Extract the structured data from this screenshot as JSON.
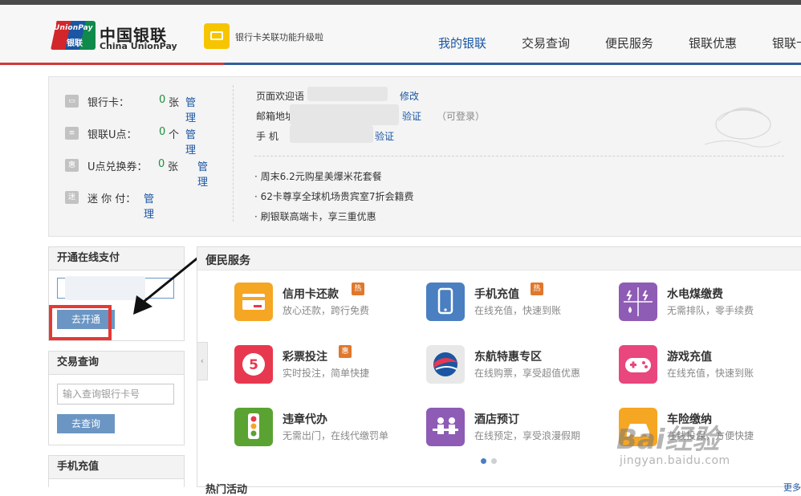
{
  "brand": {
    "logo_en_mark": "UnionPay",
    "logo_cn_mark": "银联",
    "name_cn": "中国银联",
    "name_en": "China UnionPay"
  },
  "upgrade_notice": "银行卡关联功能升级啦",
  "nav": {
    "items": [
      "我的银联",
      "交易查询",
      "便民服务",
      "银联优惠",
      "银联卡"
    ],
    "active": "我的银联"
  },
  "profile": {
    "rows": [
      {
        "label": "银行卡：",
        "count": "0",
        "unit": "张",
        "link": "管理",
        "icon": "card-icon"
      },
      {
        "label": "银联U点：",
        "count": "0",
        "unit": "个",
        "link": "管理",
        "icon": "coin-icon"
      },
      {
        "label": "U点兑换券：",
        "count": "0",
        "unit": "张",
        "link": "管理",
        "icon": "voucher-icon"
      },
      {
        "label": "迷 你 付：",
        "count": "",
        "unit": "",
        "link": "管理",
        "icon": "minipay-icon"
      }
    ],
    "welcome_label": "页面欢迎语",
    "welcome_link": "修改",
    "email_label": "邮箱地址",
    "email_link": "验证",
    "email_note": "（可登录）",
    "phone_label": "手 机",
    "phone_link": "验证",
    "news": [
      "· 周末6.2元购星美爆米花套餐",
      "· 62卡尊享全球机场贵宾室7折会籍费",
      "· 刷银联高端卡，享三重优惠"
    ]
  },
  "sidebar": {
    "online_pay": {
      "title": "开通在线支付",
      "button": "去开通"
    },
    "trade_query": {
      "title": "交易查询",
      "placeholder": "输入查询银行卡号",
      "button": "去查询"
    },
    "mobile_recharge": {
      "title": "手机充值"
    }
  },
  "services": {
    "title": "便民服务",
    "items": [
      {
        "name": "信用卡还款",
        "desc": "放心还款，跨行免费",
        "badge": "热",
        "icon": "credit-card-repay-icon",
        "color": "#f5a623"
      },
      {
        "name": "手机充值",
        "desc": "在线充值，快速到账",
        "badge": "热",
        "icon": "phone-recharge-icon",
        "color": "#4a7fc1"
      },
      {
        "name": "水电煤缴费",
        "desc": "无需排队，零手续费",
        "badge": "",
        "icon": "utility-bill-icon",
        "color": "#8e5bb5"
      },
      {
        "name": "彩票投注",
        "desc": "实时投注，简单快捷",
        "badge": "惠",
        "icon": "lottery-icon",
        "color": "#e8384f"
      },
      {
        "name": "东航特惠专区",
        "desc": "在线购票，享受超值优惠",
        "badge": "",
        "icon": "airline-icon",
        "color": "#e8e8e8"
      },
      {
        "name": "游戏充值",
        "desc": "在线充值，快速到账",
        "badge": "",
        "icon": "game-recharge-icon",
        "color": "#e8467c"
      },
      {
        "name": "违章代办",
        "desc": "无需出门，在线代缴罚单",
        "badge": "",
        "icon": "traffic-light-icon",
        "color": "#5aa332"
      },
      {
        "name": "酒店预订",
        "desc": "在线预定，享受浪漫假期",
        "badge": "",
        "icon": "hotel-icon",
        "color": "#8e5bb5"
      },
      {
        "name": "车险缴纳",
        "desc": "在线投保，方便快捷",
        "badge": "",
        "icon": "car-insurance-icon",
        "color": "#f5a623"
      }
    ]
  },
  "hot_activities": {
    "title": "热门活动",
    "more": "更多"
  },
  "watermark": {
    "line1": "Bai经验",
    "line2": "jingyan.baidu.com"
  }
}
